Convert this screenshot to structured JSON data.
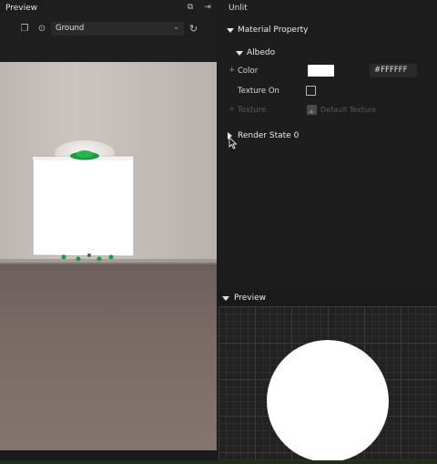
{
  "left_panel": {
    "title": "Preview",
    "scene_select": {
      "value": "Ground"
    }
  },
  "right_panel": {
    "title": "Unlit",
    "material_property": {
      "label": "Material Property",
      "albedo": {
        "label": "Albedo",
        "color": {
          "label": "Color",
          "value_hex": "#FFFFFF",
          "swatch_color": "#ffffff"
        },
        "texture_on": {
          "label": "Texture On",
          "checked": false
        },
        "texture": {
          "label": "Texture",
          "value": "Default Texture"
        }
      }
    },
    "render_state": {
      "label": "Render State 0"
    },
    "preview": {
      "label": "Preview"
    }
  },
  "icons": {
    "popout": "external-link-icon",
    "exit": "exit-icon",
    "copy": "copy-icon",
    "camera_reset": "target-icon",
    "refresh": "refresh-icon"
  },
  "colors": {
    "accent_green": "#1fa24a",
    "panel_bg": "#1d1d1d",
    "sphere": "#ffffff"
  }
}
